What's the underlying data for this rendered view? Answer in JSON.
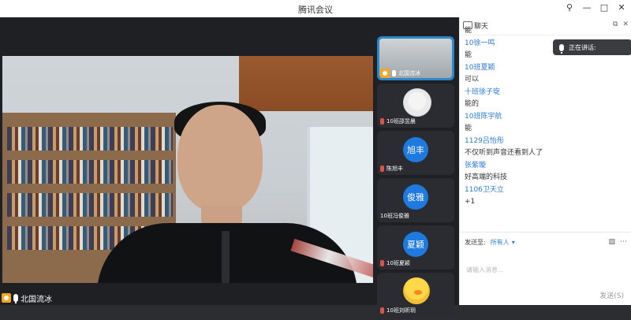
{
  "window": {
    "title": "腾讯会议",
    "controls": [
      "⚲",
      "—",
      "□",
      "✕"
    ]
  },
  "main_video": {
    "name": "北国流冰"
  },
  "participants": [
    {
      "name": "北国流冰",
      "avatar": "video"
    },
    {
      "name": "10班邵昱晨",
      "avatar": "photo"
    },
    {
      "name": "陈旭丰",
      "avatar": "circle",
      "avatar_text": "旭丰"
    },
    {
      "name": "10班冯俊雅",
      "avatar": "circle",
      "avatar_text": "俊雅"
    },
    {
      "name": "10班夏颖",
      "avatar": "circle",
      "avatar_text": "夏颖"
    },
    {
      "name": "10班刘昕玥",
      "avatar": "duck"
    }
  ],
  "chat": {
    "title": "聊天",
    "speaking_label": "正在讲话:",
    "messages": [
      {
        "type": "text",
        "value": "能"
      },
      {
        "type": "name",
        "value": "10徐一鸣"
      },
      {
        "type": "text",
        "value": "能"
      },
      {
        "type": "name",
        "value": "10班夏颖"
      },
      {
        "type": "text",
        "value": "可以"
      },
      {
        "type": "name",
        "value": "十班徐子琁"
      },
      {
        "type": "text",
        "value": "能的"
      },
      {
        "type": "name",
        "value": "10班陈宇航"
      },
      {
        "type": "text",
        "value": "能"
      },
      {
        "type": "name",
        "value": "1129吕怡彤"
      },
      {
        "type": "text",
        "value": "不仅听到声音还看到人了"
      },
      {
        "type": "name",
        "value": "张紫璇"
      },
      {
        "type": "text",
        "value": "好高端的科技"
      },
      {
        "type": "name",
        "value": "1106卫天立"
      },
      {
        "type": "text",
        "value": "+1"
      }
    ],
    "send_to_label": "发送至:",
    "send_to_value": "所有人",
    "input_placeholder": "请输入消息...",
    "send_button": "发送(S)"
  },
  "colors": {
    "accent": "#2a7bd8",
    "active_tile": "#2f86c6",
    "orange_badge": "#f5a623"
  }
}
